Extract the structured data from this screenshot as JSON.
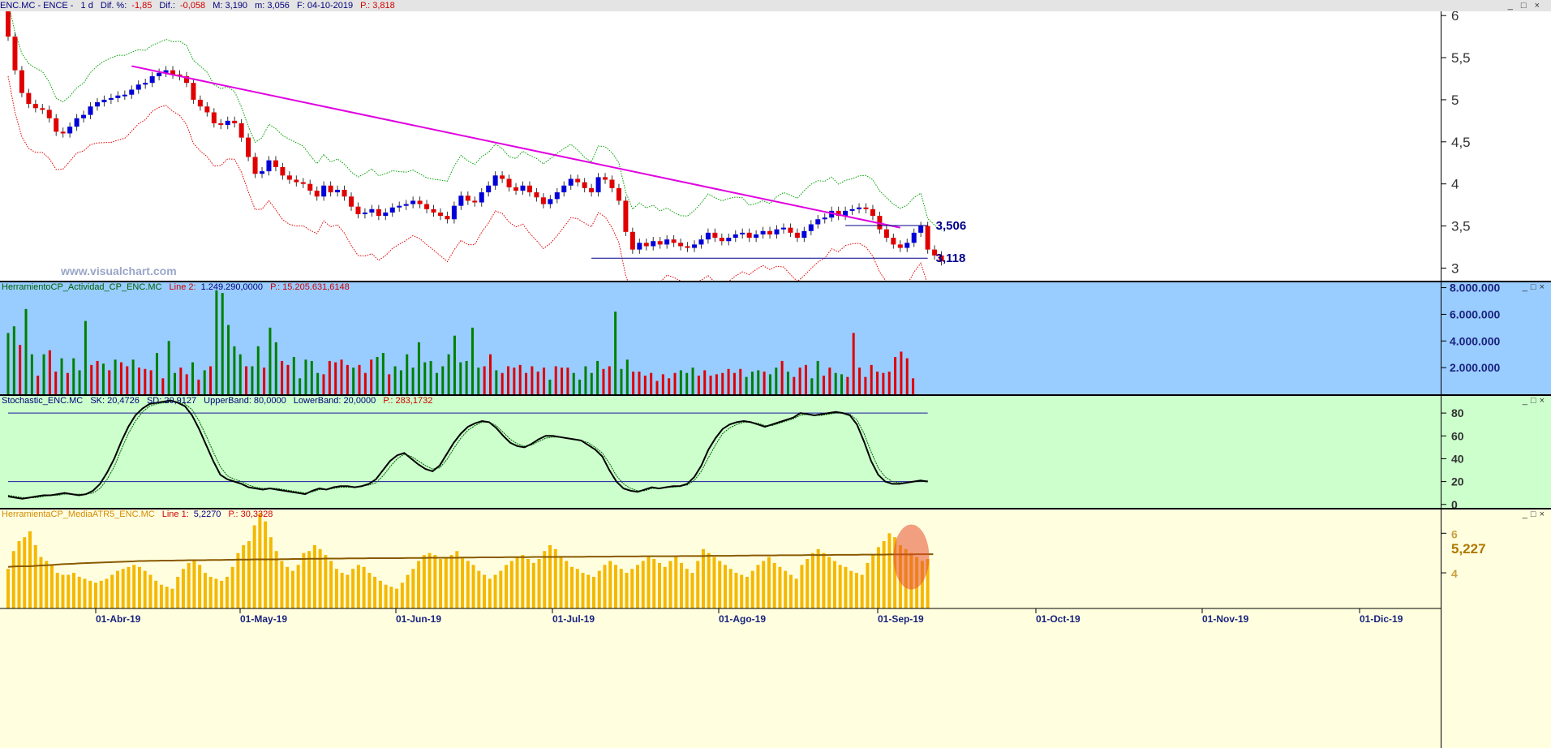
{
  "header": {
    "symbol": "ENC.MC - ENCE -",
    "period": "1 d",
    "dif_pct_label": "Dif. %:",
    "dif_pct": "-1,85",
    "dif_label": "Dif.:",
    "dif": "-0,058",
    "max": "M: 3,190",
    "min": "m: 3,056",
    "date": "F: 04-10-2019",
    "price": "P.: 3,818"
  },
  "watermark": "www.visualchart.com",
  "colors": {
    "bull": "#0000d8",
    "bear": "#e00000",
    "trend": "#e000e0",
    "upper_band": "#00a000",
    "lower_band": "#e00000",
    "vol_bg": "#99ccff",
    "stoch_bg": "#ccffcc",
    "atr_bg": "#ffffe0",
    "atr_bar": "#f5b800"
  },
  "x_axis": {
    "labels": [
      "01-Abr-19",
      "01-May-19",
      "01-Jun-19",
      "01-Jul-19",
      "01-Ago-19",
      "01-Sep-19",
      "01-Oct-19",
      "01-Nov-19",
      "01-Dic-19"
    ]
  },
  "panels": {
    "volume": {
      "name": "HerramientoCP_Actividad_CP_ENC.MC",
      "line_label": "Line 2:",
      "line_value": "1.249.290,0000",
      "p_value": "P.: 15.205.631,6148",
      "ticks": [
        "8.000.000",
        "6.000.000",
        "4.000.000",
        "2.000.000"
      ]
    },
    "stochastic": {
      "name": "Stochastic_ENC.MC",
      "sk": "SK: 20,4726",
      "sd": "SD: 20,9127",
      "upper": "UpperBand: 80,0000",
      "lower": "LowerBand: 20,0000",
      "p_value": "P.: 283,1732",
      "ticks": [
        "80",
        "60",
        "40",
        "20",
        "0"
      ]
    },
    "atr": {
      "name": "HerramientaCP_MediaATR5_ENC.MC",
      "line_label": "Line 1:",
      "line_value": "5,2270",
      "p_value": "P.: 30,3328",
      "ticks": [
        "6",
        "4"
      ],
      "last_value": "5,227"
    }
  },
  "chart_data": [
    {
      "type": "candlestick",
      "title": "ENC.MC - ENCE - 1 d",
      "y_ticks": [
        "6",
        "5,5",
        "5",
        "4,5",
        "4",
        "3,5",
        "3"
      ],
      "ylim": [
        2.85,
        6.05
      ],
      "annotations": {
        "resistance": "3,506",
        "support": "3,118"
      },
      "levels": {
        "resistance": 3.506,
        "support": 3.118
      },
      "trendline": {
        "from": [
          18,
          5.4
        ],
        "to": [
          130,
          3.48
        ]
      },
      "close": [
        5.75,
        5.35,
        5.08,
        4.95,
        4.9,
        4.88,
        4.78,
        4.62,
        4.6,
        4.68,
        4.78,
        4.82,
        4.92,
        4.97,
        5.0,
        5.02,
        5.05,
        5.06,
        5.12,
        5.18,
        5.2,
        5.28,
        5.32,
        5.35,
        5.3,
        5.28,
        5.2,
        5.0,
        4.92,
        4.85,
        4.72,
        4.7,
        4.75,
        4.72,
        4.55,
        4.32,
        4.12,
        4.15,
        4.28,
        4.2,
        4.1,
        4.05,
        4.02,
        4.0,
        3.92,
        3.85,
        3.98,
        3.9,
        3.93,
        3.85,
        3.73,
        3.64,
        3.66,
        3.7,
        3.62,
        3.66,
        3.72,
        3.74,
        3.76,
        3.8,
        3.76,
        3.7,
        3.66,
        3.62,
        3.58,
        3.74,
        3.86,
        3.8,
        3.78,
        3.9,
        3.98,
        4.1,
        4.06,
        3.96,
        3.92,
        3.98,
        3.9,
        3.84,
        3.76,
        3.82,
        3.9,
        3.98,
        4.06,
        4.02,
        3.95,
        3.9,
        4.08,
        4.05,
        3.95,
        3.8,
        3.43,
        3.22,
        3.3,
        3.26,
        3.32,
        3.28,
        3.34,
        3.3,
        3.26,
        3.24,
        3.28,
        3.34,
        3.42,
        3.36,
        3.32,
        3.36,
        3.4,
        3.42,
        3.36,
        3.4,
        3.44,
        3.4,
        3.46,
        3.48,
        3.42,
        3.36,
        3.44,
        3.52,
        3.58,
        3.6,
        3.68,
        3.62,
        3.68,
        3.7,
        3.72,
        3.7,
        3.62,
        3.46,
        3.36,
        3.28,
        3.24,
        3.3,
        3.42,
        3.5,
        3.22,
        3.15,
        3.08
      ]
    },
    {
      "type": "bar",
      "title": "HerramientoCP_Actividad_CP_ENC.MC",
      "ylim": [
        0,
        8400000
      ],
      "values": [
        4.6,
        5.1,
        3.7,
        6.4,
        3.0,
        1.4,
        3.0,
        3.3,
        1.7,
        2.7,
        1.6,
        2.7,
        1.8,
        5.5,
        2.2,
        2.5,
        2.3,
        1.8,
        2.6,
        2.4,
        2.1,
        2.6,
        2.0,
        1.9,
        1.8,
        3.1,
        1.2,
        4.0,
        1.6,
        2.0,
        1.5,
        2.4,
        1.1,
        1.8,
        2.1,
        7.8,
        7.6,
        5.2,
        3.6,
        3.0,
        2.1,
        2.1,
        3.6,
        2.0,
        5.0,
        3.9,
        2.5,
        2.2,
        2.8,
        1.2,
        2.6,
        2.5,
        1.6,
        1.5,
        2.5,
        2.4,
        2.6,
        2.2,
        2.0,
        2.2,
        1.6,
        2.6,
        2.8,
        3.1,
        1.5,
        2.1,
        1.8,
        3.0,
        2.0,
        3.9,
        2.4,
        2.5,
        1.6,
        2.1,
        3.0,
        4.4,
        2.4,
        2.5,
        5.0,
        2.0,
        2.1,
        3.0,
        1.8,
        1.6,
        2.1,
        2.0,
        2.2,
        1.6,
        2.1,
        1.7,
        2.0,
        1.1,
        2.1,
        2.0,
        2.0,
        1.6,
        1.1,
        2.1,
        1.6,
        2.5,
        1.9,
        2.1,
        6.2,
        1.9,
        2.6,
        1.7,
        1.7,
        1.4,
        1.6,
        1.0,
        1.5,
        1.2,
        1.6,
        1.8,
        1.6,
        2.0,
        1.4,
        1.8,
        1.4,
        1.5,
        1.6,
        1.9,
        1.6,
        1.9,
        1.3,
        1.7,
        1.8,
        1.7,
        1.5,
        2.0,
        2.5,
        1.7,
        1.3,
        2.0,
        2.2,
        1.2,
        2.5,
        1.4,
        2.0,
        1.6,
        1.5,
        1.3,
        4.6,
        2.0,
        1.3,
        2.2,
        1.7,
        1.6,
        1.7,
        2.8,
        3.2,
        2.7,
        1.2
      ],
      "bear": [
        0,
        0,
        1,
        0,
        0,
        1,
        0,
        1,
        1,
        0,
        1,
        0,
        0,
        0,
        1,
        1,
        0,
        1,
        0,
        1,
        1,
        0,
        1,
        1,
        1,
        0,
        1,
        0,
        0,
        1,
        1,
        0,
        1,
        0,
        1,
        0,
        0,
        0,
        0,
        0,
        1,
        0,
        0,
        1,
        0,
        0,
        1,
        1,
        0,
        0,
        0,
        0,
        0,
        1,
        1,
        1,
        1,
        1,
        0,
        1,
        1,
        1,
        0,
        0,
        1,
        0,
        0,
        0,
        0,
        0,
        0,
        0,
        0,
        0,
        0,
        0,
        0,
        0,
        0,
        0,
        1,
        1,
        0,
        1,
        1,
        1,
        1,
        1,
        1,
        1,
        1,
        0,
        1,
        1,
        1,
        0,
        0,
        0,
        0,
        0,
        1,
        1,
        0,
        0,
        0,
        1,
        1,
        1,
        1,
        1,
        1,
        1,
        1,
        0,
        0,
        0,
        1,
        1,
        1,
        1,
        1,
        1,
        1,
        1,
        0,
        0,
        0,
        1,
        0,
        0,
        1,
        0,
        1,
        1,
        1,
        0,
        0,
        1,
        1,
        0,
        0,
        1,
        1,
        1,
        1,
        1,
        1,
        1,
        1,
        1,
        1,
        1,
        1
      ],
      "unit_note": "millions"
    },
    {
      "type": "line",
      "title": "Stochastic_ENC.MC",
      "ylim": [
        -3,
        95
      ],
      "series": [
        {
          "name": "SK",
          "values": [
            7,
            6,
            5,
            6,
            7,
            8,
            8,
            9,
            10,
            9,
            8,
            9,
            12,
            18,
            28,
            40,
            55,
            68,
            78,
            84,
            88,
            89,
            90,
            91,
            89,
            86,
            78,
            66,
            52,
            38,
            26,
            22,
            20,
            18,
            15,
            14,
            13,
            14,
            13,
            12,
            11,
            10,
            9,
            12,
            14,
            13,
            15,
            16,
            16,
            15,
            16,
            18,
            22,
            30,
            38,
            43,
            45,
            40,
            35,
            31,
            29,
            34,
            44,
            54,
            62,
            68,
            71,
            73,
            72,
            67,
            60,
            54,
            51,
            50,
            53,
            57,
            60,
            60,
            59,
            58,
            57,
            56,
            52,
            48,
            42,
            30,
            20,
            14,
            12,
            11,
            13,
            15,
            14,
            15,
            16,
            16,
            18,
            24,
            34,
            48,
            58,
            66,
            70,
            72,
            73,
            72,
            70,
            68,
            70,
            72,
            74,
            76,
            80,
            79,
            78,
            79,
            80,
            81,
            80,
            78,
            70,
            55,
            38,
            26,
            20,
            18,
            18,
            19,
            20,
            21,
            20
          ]
        },
        {
          "name": "SD",
          "values": [
            8,
            7,
            6,
            6,
            6,
            7,
            8,
            8,
            9,
            9,
            9,
            9,
            10,
            14,
            22,
            33,
            48,
            62,
            73,
            81,
            86,
            88,
            89,
            90,
            90,
            88,
            83,
            73,
            60,
            46,
            33,
            25,
            22,
            20,
            17,
            15,
            14,
            14,
            14,
            13,
            12,
            11,
            10,
            11,
            13,
            13,
            14,
            15,
            15,
            15,
            16,
            17,
            19,
            25,
            33,
            40,
            44,
            42,
            38,
            34,
            31,
            32,
            39,
            49,
            58,
            65,
            69,
            72,
            72,
            69,
            63,
            57,
            53,
            51,
            52,
            55,
            58,
            59,
            59,
            58,
            57,
            56,
            54,
            50,
            45,
            36,
            25,
            18,
            14,
            12,
            12,
            14,
            14,
            15,
            15,
            16,
            17,
            21,
            29,
            41,
            52,
            62,
            67,
            70,
            72,
            72,
            71,
            69,
            69,
            71,
            73,
            75,
            78,
            79,
            78,
            78,
            79,
            80,
            80,
            79,
            74,
            62,
            46,
            32,
            24,
            20,
            19,
            19,
            20,
            20,
            21
          ]
        }
      ],
      "bands": {
        "upper": 80,
        "lower": 20
      }
    },
    {
      "type": "bar",
      "title": "HerramientaCP_MediaATR5_ENC.MC",
      "ylim": [
        2.2,
        7.2
      ],
      "values": [
        4.2,
        5.1,
        5.6,
        5.8,
        6.1,
        5.4,
        4.8,
        4.6,
        4.4,
        4.0,
        3.9,
        3.9,
        4.0,
        3.8,
        3.7,
        3.6,
        3.5,
        3.6,
        3.7,
        3.9,
        4.1,
        4.2,
        4.3,
        4.4,
        4.3,
        4.1,
        3.9,
        3.6,
        3.4,
        3.3,
        3.2,
        3.8,
        4.2,
        4.5,
        4.6,
        4.4,
        4.0,
        3.8,
        3.7,
        3.6,
        3.8,
        4.3,
        5.0,
        5.4,
        5.6,
        6.4,
        7.0,
        6.6,
        5.8,
        5.1,
        4.6,
        4.3,
        4.1,
        4.4,
        5.0,
        5.1,
        5.4,
        5.2,
        4.9,
        4.6,
        4.2,
        4.0,
        3.9,
        4.2,
        4.4,
        4.3,
        4.0,
        3.8,
        3.6,
        3.4,
        3.3,
        3.2,
        3.5,
        3.9,
        4.2,
        4.6,
        4.9,
        5.0,
        4.9,
        4.7,
        4.8,
        4.9,
        5.1,
        4.8,
        4.6,
        4.4,
        4.1,
        3.9,
        3.7,
        3.9,
        4.1,
        4.4,
        4.6,
        4.8,
        4.9,
        4.7,
        4.5,
        4.7,
        5.1,
        5.4,
        5.2,
        4.8,
        4.6,
        4.3,
        4.2,
        4.0,
        3.9,
        3.8,
        4.1,
        4.4,
        4.6,
        4.4,
        4.2,
        4.0,
        4.2,
        4.4,
        4.6,
        4.8,
        4.7,
        4.5,
        4.3,
        4.6,
        4.8,
        4.5,
        4.2,
        4.0,
        4.6,
        5.2,
        5.0,
        4.8,
        4.6,
        4.4,
        4.2,
        4.0,
        3.9,
        3.8,
        4.1,
        4.4,
        4.6,
        4.8,
        4.5,
        4.3,
        4.1,
        3.9,
        3.7,
        4.4,
        4.7,
        5.0,
        5.2,
        5.0,
        4.8,
        4.6,
        4.4,
        4.3,
        4.1,
        4.0,
        3.9,
        4.5,
        4.9,
        5.3,
        5.6,
        6.0,
        5.8,
        5.4,
        5.2,
        5.0,
        4.8,
        4.6,
        4.7
      ],
      "average": [
        4.3,
        4.32,
        4.33,
        4.33,
        4.33,
        4.35,
        4.37,
        4.38,
        4.4,
        4.42,
        4.44,
        4.45,
        4.46,
        4.48,
        4.49,
        4.5,
        4.51,
        4.52,
        4.53,
        4.54,
        4.55,
        4.56,
        4.57,
        4.58,
        4.6,
        4.6,
        4.61,
        4.61,
        4.62,
        4.62,
        4.62,
        4.63,
        4.63,
        4.64,
        4.64,
        4.64,
        4.64,
        4.65,
        4.65,
        4.65,
        4.66,
        4.66,
        4.67,
        4.67,
        4.67,
        4.68,
        4.68,
        4.68,
        4.68,
        4.68,
        4.69,
        4.69,
        4.7,
        4.7,
        4.7,
        4.71,
        4.71,
        4.71,
        4.72,
        4.72,
        4.72,
        4.72,
        4.73,
        4.73,
        4.73,
        4.73,
        4.74,
        4.74,
        4.74,
        4.74,
        4.74,
        4.74,
        4.74,
        4.75,
        4.75,
        4.75,
        4.75,
        4.76,
        4.76,
        4.76,
        4.76,
        4.76,
        4.76,
        4.77,
        4.77,
        4.77,
        4.78,
        4.78,
        4.78,
        4.78,
        4.78,
        4.79,
        4.79,
        4.79,
        4.79,
        4.79,
        4.8,
        4.8,
        4.8,
        4.8,
        4.8,
        4.81,
        4.81,
        4.81,
        4.81,
        4.81,
        4.82,
        4.82,
        4.82,
        4.82,
        4.82,
        4.83,
        4.83,
        4.83,
        4.83,
        4.83,
        4.84,
        4.84,
        4.84,
        4.84,
        4.84,
        4.84,
        4.84,
        4.85,
        4.85,
        4.85,
        4.85,
        4.85,
        4.86,
        4.86,
        4.86,
        4.86,
        4.86,
        4.87,
        4.87,
        4.87,
        4.88,
        4.88,
        4.88,
        4.88,
        4.88,
        4.89,
        4.89,
        4.89,
        4.89,
        4.89,
        4.9,
        4.9,
        4.9,
        4.9,
        4.9,
        4.91,
        4.91,
        4.91,
        4.91,
        4.91,
        4.92,
        4.92,
        4.92,
        4.92,
        4.92,
        4.93,
        4.93,
        4.93,
        4.93,
        4.93,
        4.94,
        4.94,
        4.94,
        4.94
      ]
    }
  ]
}
